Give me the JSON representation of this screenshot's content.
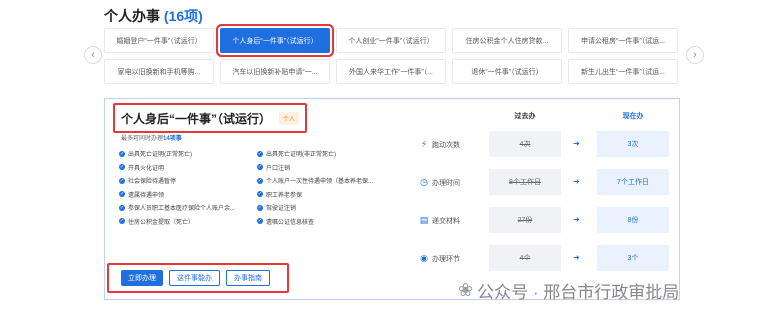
{
  "header": {
    "title": "个人办事",
    "count": "(16项)"
  },
  "nav": {
    "prev_icon": "chevron-left-icon",
    "next_icon": "chevron-right-icon"
  },
  "services_row1": [
    "婚姻登户“一件事”（试运行）",
    "个人身后“一件事”（试运行）",
    "个人创业“一件事”（试运行）",
    "住房公积金个人住房贷款...",
    "申请公租房“一件事”（试运..."
  ],
  "services_row2": [
    "家电以旧换新和手机等购...",
    "汽车以旧换新补贴申请“一...",
    "外国人来华工作“一件事”（...",
    "退休“一件事”（试运行）",
    "新生儿出生“一件事”（试运..."
  ],
  "detail": {
    "title": "个人身后“一件事”（试运行）",
    "badge": "个人",
    "subtitle_prefix": "最多可同时办理",
    "subtitle_count": "14项事",
    "items": [
      "出具死亡证明(正常死亡)",
      "出具死亡证明(非正常死亡)",
      "开具火化证明",
      "户口注销",
      "社会保险待遇暂停",
      "个人账户一次性待遇申领（基本养老保...",
      "遗属待遇申领",
      "职工养老参保",
      "参保人员职工基本医疗保险个人账户余...",
      "驾驶证注销",
      "住房公积金提取（死亡）",
      "遗嘱公证信息核查"
    ],
    "actions": {
      "apply": "立即办理",
      "guide": "这件事能办",
      "process": "办事指南"
    }
  },
  "compare": {
    "past_label": "过去办",
    "now_label": "现在办",
    "rows": [
      {
        "icon": "run-icon",
        "metric": "跑动次数",
        "past": "4次",
        "now": "3次"
      },
      {
        "icon": "clock-icon",
        "metric": "办理时间",
        "past": "8个工作日",
        "now": "7个工作日"
      },
      {
        "icon": "folder-icon",
        "metric": "递交材料",
        "past": "27份",
        "now": "8份"
      },
      {
        "icon": "link-icon",
        "metric": "办理环节",
        "past": "4个",
        "now": "3个"
      }
    ]
  },
  "watermark": {
    "text": "公众号 · 邢台市行政审批局",
    "icon": "wechat-icon"
  }
}
